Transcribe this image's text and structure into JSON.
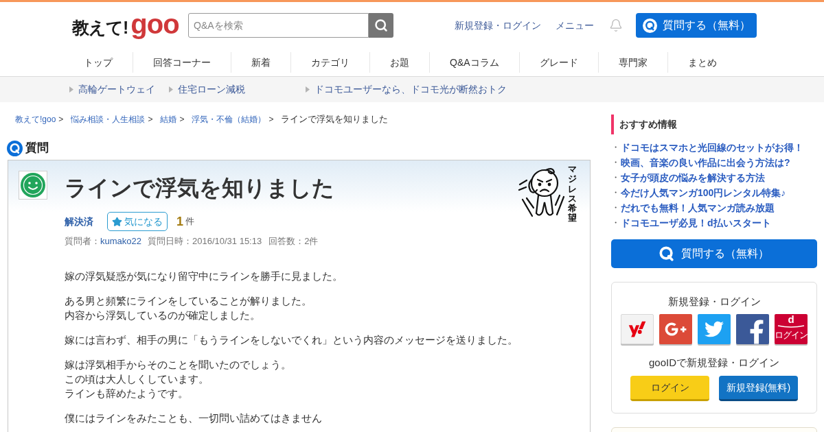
{
  "header": {
    "logo": {
      "text": "教えて!",
      "brand": "goo"
    },
    "search": {
      "placeholder": "Q&Aを検索"
    },
    "links": [
      "新規登録・ログイン",
      "メニュー"
    ],
    "ask_button": "質問する（無料）"
  },
  "nav": [
    "トップ",
    "回答コーナー",
    "新着",
    "カテゴリ",
    "お題",
    "Q&Aコラム",
    "グレード",
    "専門家",
    "まとめ"
  ],
  "promo_links": [
    "高輪ゲートウェイ",
    "住宅ローン減税",
    "ドコモユーザーなら、ドコモ光が断然おトク"
  ],
  "breadcrumb": [
    {
      "label": "教えて!goo",
      "current": false,
      "separator": ">"
    },
    {
      "label": "悩み相談・人生相談",
      "current": false,
      "separator": ">"
    },
    {
      "label": "結婚",
      "current": false,
      "separator": ">"
    },
    {
      "label": "浮気・不倫（結婚）",
      "current": false,
      "separator": ">"
    },
    {
      "label": "ラインで浮気を知りました",
      "current": true
    }
  ],
  "question": {
    "heading": "質問",
    "title": "ラインで浮気を知りました",
    "sticker_text": "マジレス希望",
    "status": "解決済",
    "watch_button": "気になる",
    "watch_count": "1",
    "watch_unit": "件",
    "asker_label": "質問者：",
    "asker": "kumako22",
    "posted": "質問日時：2016/10/31 15:13",
    "answers": "回答数：2件",
    "body": [
      [
        "嫁の浮気疑惑が気になり留守中にラインを勝手に見ました。"
      ],
      [
        "ある男と頻繁にラインをしていることが解りました。",
        "内容から浮気しているのが確定しました。"
      ],
      [
        "嫁には言わず、相手の男に「もうラインをしないでくれ」という内容のメッセージを送りました。"
      ],
      [
        "嫁は浮気相手からそのことを聞いたのでしょう。",
        "この頃は大人しくしています。",
        "ラインも辞めたようです。"
      ],
      [
        "僕にはラインをみたことも、一切問い詰めてはきません"
      ]
    ]
  },
  "sidebar": {
    "recommended": {
      "heading": "おすすめ情報",
      "items": [
        {
          "marker": "・",
          "label": "ドコモはスマホと光回線のセットがお得！"
        },
        {
          "marker": "・",
          "label": "映画、音楽の良い作品に出会う方法は?"
        },
        {
          "marker": "・",
          "label": "女子が頭皮の悩みを解決する方法"
        },
        {
          "marker": "・",
          "label": "今だけ人気マンガ100円レンタル特集♪"
        },
        {
          "marker": "・",
          "label": "だれでも無料！人気マンガ読み放題"
        },
        {
          "marker": "・",
          "label": "ドコモユーザ必見！d払いスタート"
        }
      ]
    },
    "ask_button": "質問する（無料）",
    "login": {
      "heading": "新規登録・ログイン",
      "providers": [
        {
          "kind": "yahoo"
        },
        {
          "kind": "google"
        },
        {
          "kind": "twitter"
        },
        {
          "kind": "facebook"
        },
        {
          "kind": "docomo",
          "label": "d",
          "caption": "ログイン"
        }
      ],
      "goo_heading": "gooIDで新規登録・ログイン",
      "buttons": [
        {
          "kind": "login",
          "label": "ログイン"
        },
        {
          "kind": "register",
          "label": "新規登録(無料)"
        }
      ]
    }
  }
}
